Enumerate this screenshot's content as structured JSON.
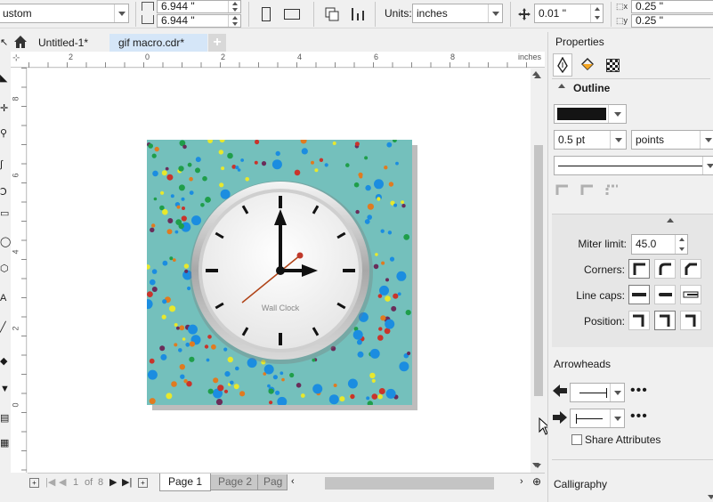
{
  "toolbar": {
    "page_preset": "ustom",
    "width": "6.944 \"",
    "height": "6.944 \"",
    "units_label": "Units:",
    "units_value": "inches",
    "nudge": "0.01 \"",
    "dup_x": "0.25 \"",
    "dup_y": "0.25 \""
  },
  "tabs": [
    {
      "label": "Untitled-1*"
    },
    {
      "label": "gif macro.cdr*"
    }
  ],
  "ruler": {
    "units": "inches",
    "top_ticks": [
      "2",
      "0",
      "2",
      "4",
      "6",
      "8"
    ],
    "left_ticks": [
      "8",
      "6",
      "4",
      "2",
      "0"
    ]
  },
  "clock": {
    "label": "Wall Clock"
  },
  "page_nav": {
    "current": "1",
    "of_label": "of",
    "total": "8",
    "pages": [
      "Page 1",
      "Page 2",
      "Pag"
    ]
  },
  "properties": {
    "title": "Properties",
    "outline_header": "Outline",
    "outline_color": "#141414",
    "width_value": "0.5 pt",
    "width_units": "points",
    "miter_label": "Miter limit:",
    "miter_value": "45.0",
    "corners_label": "Corners:",
    "linecaps_label": "Line caps:",
    "position_label": "Position:",
    "arrowheads_header": "Arrowheads",
    "share_attributes": "Share Attributes",
    "calligraphy_header": "Calligraphy"
  },
  "colors": {
    "canvas_bg": "#74c0bc",
    "accent_tab": "#d5e6f8"
  }
}
